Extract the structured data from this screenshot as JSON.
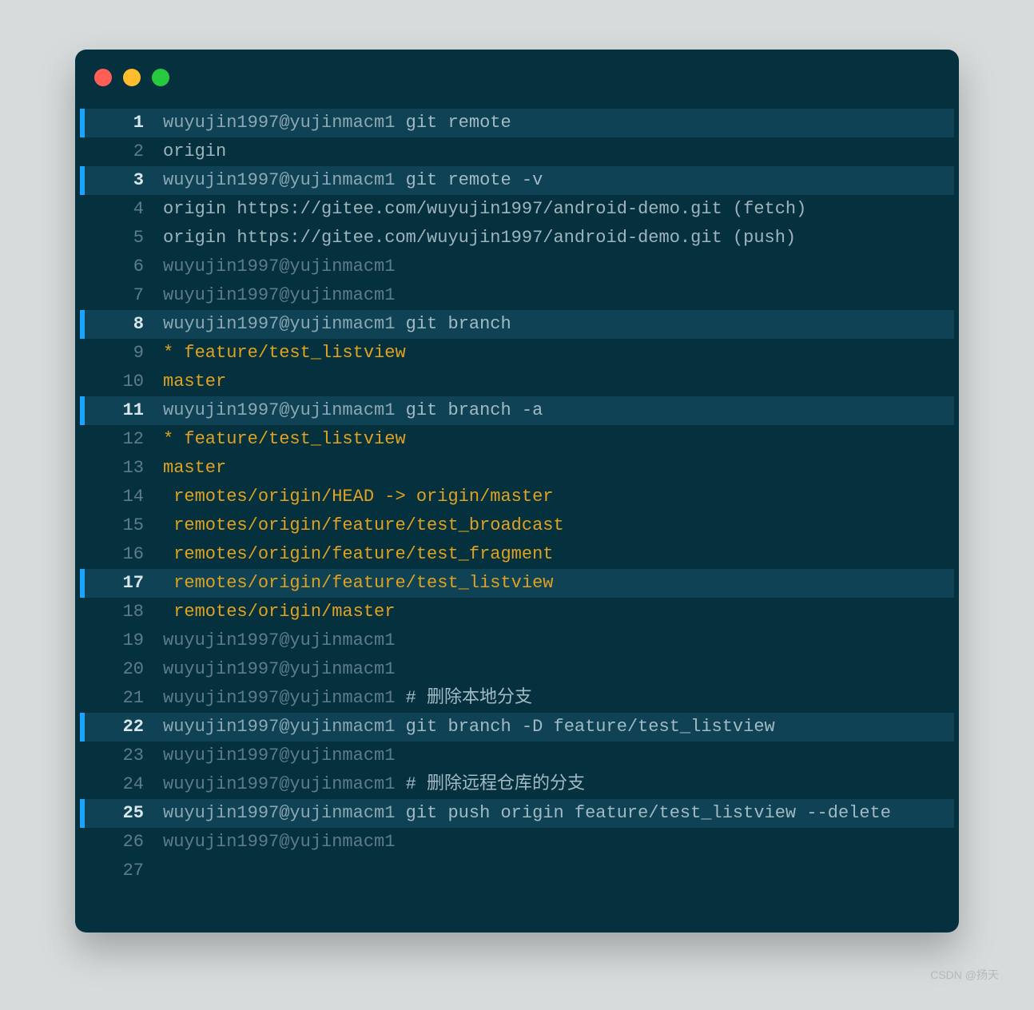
{
  "watermark": "CSDN @扬天",
  "prompt": "wuyujin1997@yujinmacm1",
  "lines": [
    {
      "n": 1,
      "hl": true,
      "type": "cmd",
      "cmd": "git remote"
    },
    {
      "n": 2,
      "hl": false,
      "type": "out",
      "color": "g",
      "text": "origin"
    },
    {
      "n": 3,
      "hl": true,
      "type": "cmd",
      "cmd": "git remote -v"
    },
    {
      "n": 4,
      "hl": false,
      "type": "out",
      "color": "g",
      "text": "origin https://gitee.com/wuyujin1997/android-demo.git (fetch)"
    },
    {
      "n": 5,
      "hl": false,
      "type": "out",
      "color": "g",
      "text": "origin https://gitee.com/wuyujin1997/android-demo.git (push)"
    },
    {
      "n": 6,
      "hl": false,
      "type": "cmd",
      "cmd": ""
    },
    {
      "n": 7,
      "hl": false,
      "type": "cmd",
      "cmd": ""
    },
    {
      "n": 8,
      "hl": true,
      "type": "cmd",
      "cmd": "git branch"
    },
    {
      "n": 9,
      "hl": false,
      "type": "out",
      "color": "y",
      "text": "* feature/test_listview"
    },
    {
      "n": 10,
      "hl": false,
      "type": "out",
      "color": "y",
      "text": "master"
    },
    {
      "n": 11,
      "hl": true,
      "type": "cmd",
      "cmd": "git branch -a"
    },
    {
      "n": 12,
      "hl": false,
      "type": "out",
      "color": "y",
      "text": "* feature/test_listview"
    },
    {
      "n": 13,
      "hl": false,
      "type": "out",
      "color": "y",
      "text": "master"
    },
    {
      "n": 14,
      "hl": false,
      "type": "out",
      "color": "y",
      "text": " remotes/origin/HEAD -> origin/master"
    },
    {
      "n": 15,
      "hl": false,
      "type": "out",
      "color": "y",
      "text": " remotes/origin/feature/test_broadcast"
    },
    {
      "n": 16,
      "hl": false,
      "type": "out",
      "color": "y",
      "text": " remotes/origin/feature/test_fragment"
    },
    {
      "n": 17,
      "hl": true,
      "type": "out",
      "color": "y",
      "text": " remotes/origin/feature/test_listview"
    },
    {
      "n": 18,
      "hl": false,
      "type": "out",
      "color": "y",
      "text": " remotes/origin/master"
    },
    {
      "n": 19,
      "hl": false,
      "type": "cmd",
      "cmd": ""
    },
    {
      "n": 20,
      "hl": false,
      "type": "cmd",
      "cmd": ""
    },
    {
      "n": 21,
      "hl": false,
      "type": "cmd",
      "cmd": "# 删除本地分支"
    },
    {
      "n": 22,
      "hl": true,
      "type": "cmd",
      "cmd": "git branch -D feature/test_listview"
    },
    {
      "n": 23,
      "hl": false,
      "type": "cmd",
      "cmd": ""
    },
    {
      "n": 24,
      "hl": false,
      "type": "cmd",
      "cmd": "# 删除远程仓库的分支"
    },
    {
      "n": 25,
      "hl": true,
      "type": "cmd",
      "cmd": "git push origin feature/test_listview --delete"
    },
    {
      "n": 26,
      "hl": false,
      "type": "cmd",
      "cmd": ""
    },
    {
      "n": 27,
      "hl": false,
      "type": "blank",
      "text": ""
    }
  ]
}
